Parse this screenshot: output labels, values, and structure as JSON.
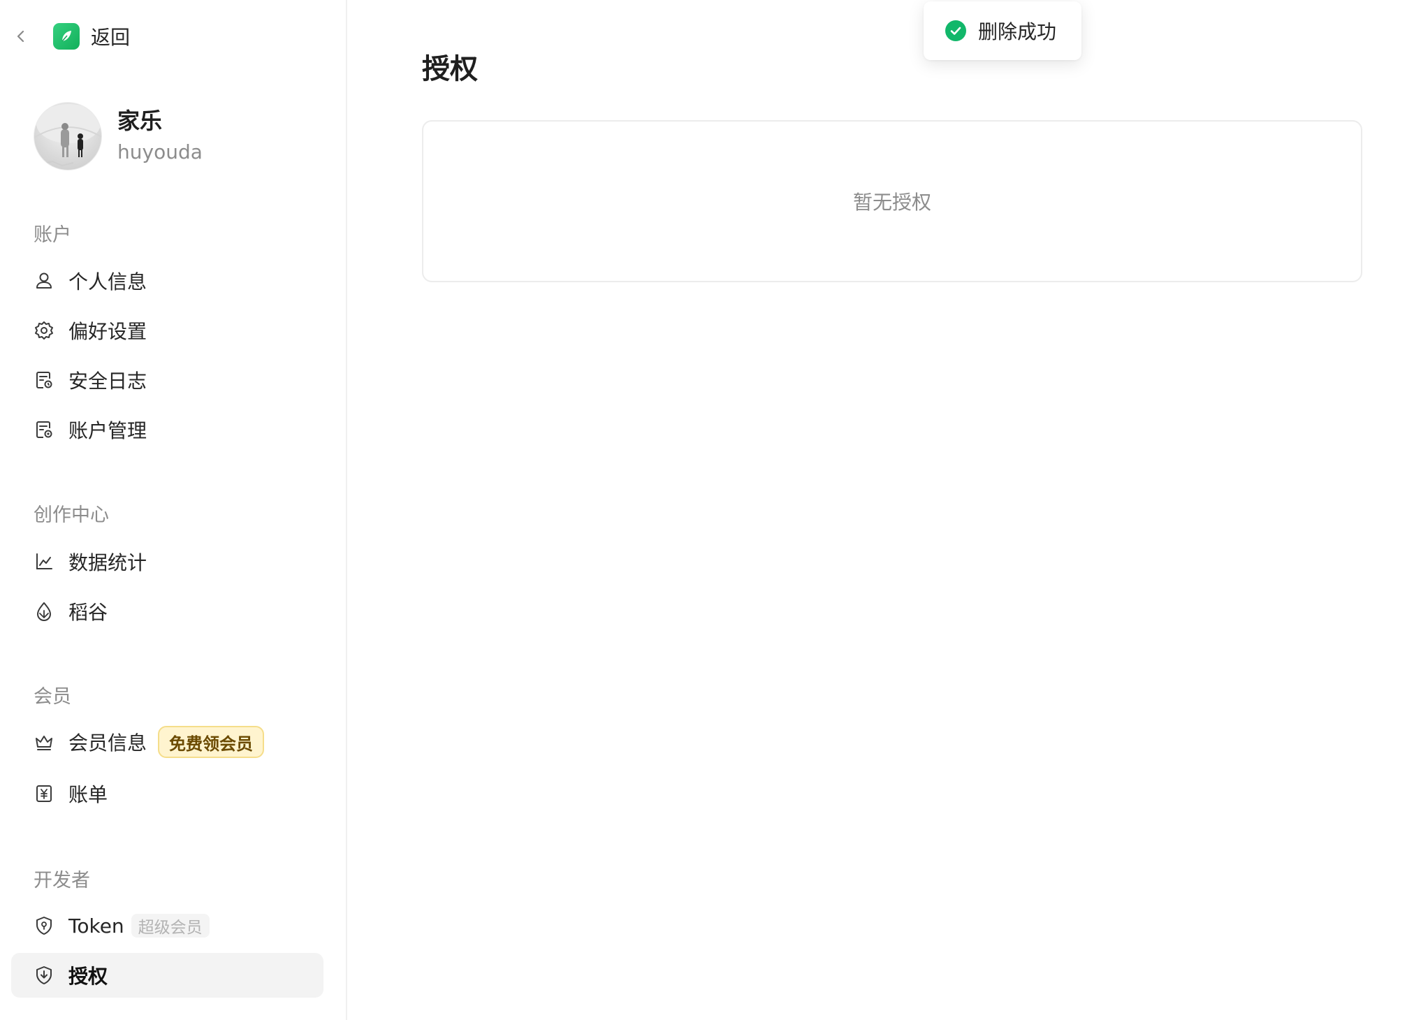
{
  "header": {
    "back_label": "返回"
  },
  "profile": {
    "name": "家乐",
    "username": "huyouda"
  },
  "sidebar": {
    "sections": [
      {
        "title": "账户"
      },
      {
        "title": "创作中心"
      },
      {
        "title": "会员"
      },
      {
        "title": "开发者"
      }
    ],
    "items": [
      {
        "label": "个人信息",
        "icon": "user-icon"
      },
      {
        "label": "偏好设置",
        "icon": "gear-icon"
      },
      {
        "label": "安全日志",
        "icon": "log-icon"
      },
      {
        "label": "账户管理",
        "icon": "account-manage-icon"
      },
      {
        "label": "数据统计",
        "icon": "chart-icon"
      },
      {
        "label": "稻谷",
        "icon": "grain-icon"
      },
      {
        "label": "会员信息",
        "icon": "crown-icon",
        "badge": "免费领会员"
      },
      {
        "label": "账单",
        "icon": "yen-icon"
      },
      {
        "label": "Token",
        "icon": "shield-icon",
        "badge": "超级会员"
      },
      {
        "label": "授权",
        "icon": "authorize-icon",
        "active": true
      }
    ]
  },
  "main": {
    "title": "授权",
    "empty_text": "暂无授权"
  },
  "toast": {
    "text": "删除成功",
    "icon": "check-circle-icon",
    "color": "#12b76a"
  },
  "colors": {
    "active_bg": "#f3f3f3",
    "badge_gold_bg": "#fff4cf",
    "success": "#12b76a"
  }
}
